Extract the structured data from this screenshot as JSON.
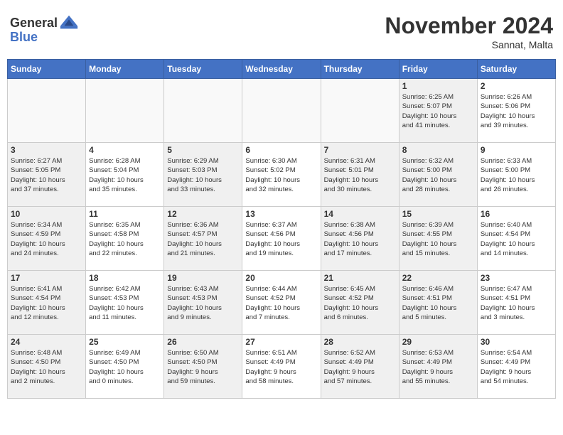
{
  "header": {
    "logo_general": "General",
    "logo_blue": "Blue",
    "month": "November 2024",
    "location": "Sannat, Malta"
  },
  "days_of_week": [
    "Sunday",
    "Monday",
    "Tuesday",
    "Wednesday",
    "Thursday",
    "Friday",
    "Saturday"
  ],
  "weeks": [
    [
      {
        "day": "",
        "info": "",
        "empty": true
      },
      {
        "day": "",
        "info": "",
        "empty": true
      },
      {
        "day": "",
        "info": "",
        "empty": true
      },
      {
        "day": "",
        "info": "",
        "empty": true
      },
      {
        "day": "",
        "info": "",
        "empty": true
      },
      {
        "day": "1",
        "info": "Sunrise: 6:25 AM\nSunset: 5:07 PM\nDaylight: 10 hours\nand 41 minutes.",
        "shaded": true
      },
      {
        "day": "2",
        "info": "Sunrise: 6:26 AM\nSunset: 5:06 PM\nDaylight: 10 hours\nand 39 minutes."
      }
    ],
    [
      {
        "day": "3",
        "info": "Sunrise: 6:27 AM\nSunset: 5:05 PM\nDaylight: 10 hours\nand 37 minutes.",
        "shaded": true
      },
      {
        "day": "4",
        "info": "Sunrise: 6:28 AM\nSunset: 5:04 PM\nDaylight: 10 hours\nand 35 minutes."
      },
      {
        "day": "5",
        "info": "Sunrise: 6:29 AM\nSunset: 5:03 PM\nDaylight: 10 hours\nand 33 minutes.",
        "shaded": true
      },
      {
        "day": "6",
        "info": "Sunrise: 6:30 AM\nSunset: 5:02 PM\nDaylight: 10 hours\nand 32 minutes."
      },
      {
        "day": "7",
        "info": "Sunrise: 6:31 AM\nSunset: 5:01 PM\nDaylight: 10 hours\nand 30 minutes.",
        "shaded": true
      },
      {
        "day": "8",
        "info": "Sunrise: 6:32 AM\nSunset: 5:00 PM\nDaylight: 10 hours\nand 28 minutes.",
        "shaded": true
      },
      {
        "day": "9",
        "info": "Sunrise: 6:33 AM\nSunset: 5:00 PM\nDaylight: 10 hours\nand 26 minutes."
      }
    ],
    [
      {
        "day": "10",
        "info": "Sunrise: 6:34 AM\nSunset: 4:59 PM\nDaylight: 10 hours\nand 24 minutes.",
        "shaded": true
      },
      {
        "day": "11",
        "info": "Sunrise: 6:35 AM\nSunset: 4:58 PM\nDaylight: 10 hours\nand 22 minutes."
      },
      {
        "day": "12",
        "info": "Sunrise: 6:36 AM\nSunset: 4:57 PM\nDaylight: 10 hours\nand 21 minutes.",
        "shaded": true
      },
      {
        "day": "13",
        "info": "Sunrise: 6:37 AM\nSunset: 4:56 PM\nDaylight: 10 hours\nand 19 minutes."
      },
      {
        "day": "14",
        "info": "Sunrise: 6:38 AM\nSunset: 4:56 PM\nDaylight: 10 hours\nand 17 minutes.",
        "shaded": true
      },
      {
        "day": "15",
        "info": "Sunrise: 6:39 AM\nSunset: 4:55 PM\nDaylight: 10 hours\nand 15 minutes.",
        "shaded": true
      },
      {
        "day": "16",
        "info": "Sunrise: 6:40 AM\nSunset: 4:54 PM\nDaylight: 10 hours\nand 14 minutes."
      }
    ],
    [
      {
        "day": "17",
        "info": "Sunrise: 6:41 AM\nSunset: 4:54 PM\nDaylight: 10 hours\nand 12 minutes.",
        "shaded": true
      },
      {
        "day": "18",
        "info": "Sunrise: 6:42 AM\nSunset: 4:53 PM\nDaylight: 10 hours\nand 11 minutes."
      },
      {
        "day": "19",
        "info": "Sunrise: 6:43 AM\nSunset: 4:53 PM\nDaylight: 10 hours\nand 9 minutes.",
        "shaded": true
      },
      {
        "day": "20",
        "info": "Sunrise: 6:44 AM\nSunset: 4:52 PM\nDaylight: 10 hours\nand 7 minutes."
      },
      {
        "day": "21",
        "info": "Sunrise: 6:45 AM\nSunset: 4:52 PM\nDaylight: 10 hours\nand 6 minutes.",
        "shaded": true
      },
      {
        "day": "22",
        "info": "Sunrise: 6:46 AM\nSunset: 4:51 PM\nDaylight: 10 hours\nand 5 minutes.",
        "shaded": true
      },
      {
        "day": "23",
        "info": "Sunrise: 6:47 AM\nSunset: 4:51 PM\nDaylight: 10 hours\nand 3 minutes."
      }
    ],
    [
      {
        "day": "24",
        "info": "Sunrise: 6:48 AM\nSunset: 4:50 PM\nDaylight: 10 hours\nand 2 minutes.",
        "shaded": true
      },
      {
        "day": "25",
        "info": "Sunrise: 6:49 AM\nSunset: 4:50 PM\nDaylight: 10 hours\nand 0 minutes."
      },
      {
        "day": "26",
        "info": "Sunrise: 6:50 AM\nSunset: 4:50 PM\nDaylight: 9 hours\nand 59 minutes.",
        "shaded": true
      },
      {
        "day": "27",
        "info": "Sunrise: 6:51 AM\nSunset: 4:49 PM\nDaylight: 9 hours\nand 58 minutes."
      },
      {
        "day": "28",
        "info": "Sunrise: 6:52 AM\nSunset: 4:49 PM\nDaylight: 9 hours\nand 57 minutes.",
        "shaded": true
      },
      {
        "day": "29",
        "info": "Sunrise: 6:53 AM\nSunset: 4:49 PM\nDaylight: 9 hours\nand 55 minutes.",
        "shaded": true
      },
      {
        "day": "30",
        "info": "Sunrise: 6:54 AM\nSunset: 4:49 PM\nDaylight: 9 hours\nand 54 minutes."
      }
    ]
  ]
}
